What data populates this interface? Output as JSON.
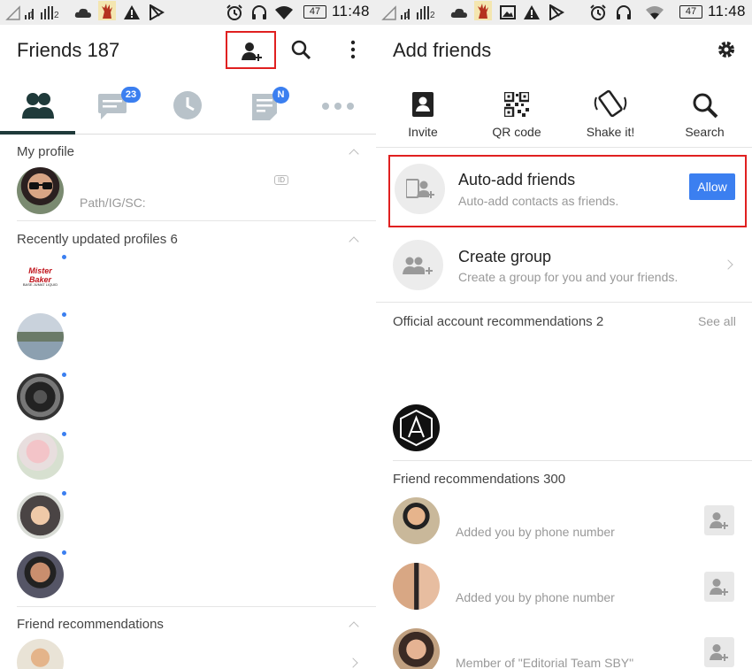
{
  "left": {
    "status": {
      "sim1": "1",
      "sim2": "2",
      "battery": "47",
      "time": "11:48"
    },
    "header": {
      "title": "Friends 187"
    },
    "tabs": [
      {
        "name": "friends"
      },
      {
        "name": "chats",
        "badge": "23"
      },
      {
        "name": "timeline"
      },
      {
        "name": "news",
        "badge": "N"
      },
      {
        "name": "more"
      }
    ],
    "my_profile": {
      "label": "My profile",
      "status_text": "Path/IG/SC:",
      "id_badge": "ID"
    },
    "recent": {
      "label": "Recently updated profiles 6",
      "logo_line1": "Mister Baker",
      "logo_line2": "BASE JUMAT LIQUID"
    },
    "friend_rec": {
      "label": "Friend recommendations"
    }
  },
  "right": {
    "status": {
      "sim1": "1",
      "sim2": "2",
      "battery": "47",
      "time": "11:48"
    },
    "header": {
      "title": "Add friends"
    },
    "actions": [
      {
        "label": "Invite"
      },
      {
        "label": "QR code"
      },
      {
        "label": "Shake it!"
      },
      {
        "label": "Search"
      }
    ],
    "auto_add": {
      "title": "Auto-add friends",
      "subtitle": "Auto-add contacts as friends.",
      "button": "Allow"
    },
    "create_group": {
      "title": "Create group",
      "subtitle": "Create a group for you and your friends."
    },
    "official": {
      "label": "Official account recommendations 2",
      "see_all": "See all"
    },
    "friend_rec": {
      "label": "Friend recommendations 300",
      "items": [
        {
          "note": "Added you by phone number"
        },
        {
          "note": "Added you by phone number"
        },
        {
          "note": "Member of \"Editorial Team SBY\""
        }
      ]
    }
  },
  "colors": {
    "accent": "#3b7ff0",
    "highlight": "#e02020",
    "tab_active": "#1f3a3a",
    "tab_inactive": "#b8c2c9"
  }
}
